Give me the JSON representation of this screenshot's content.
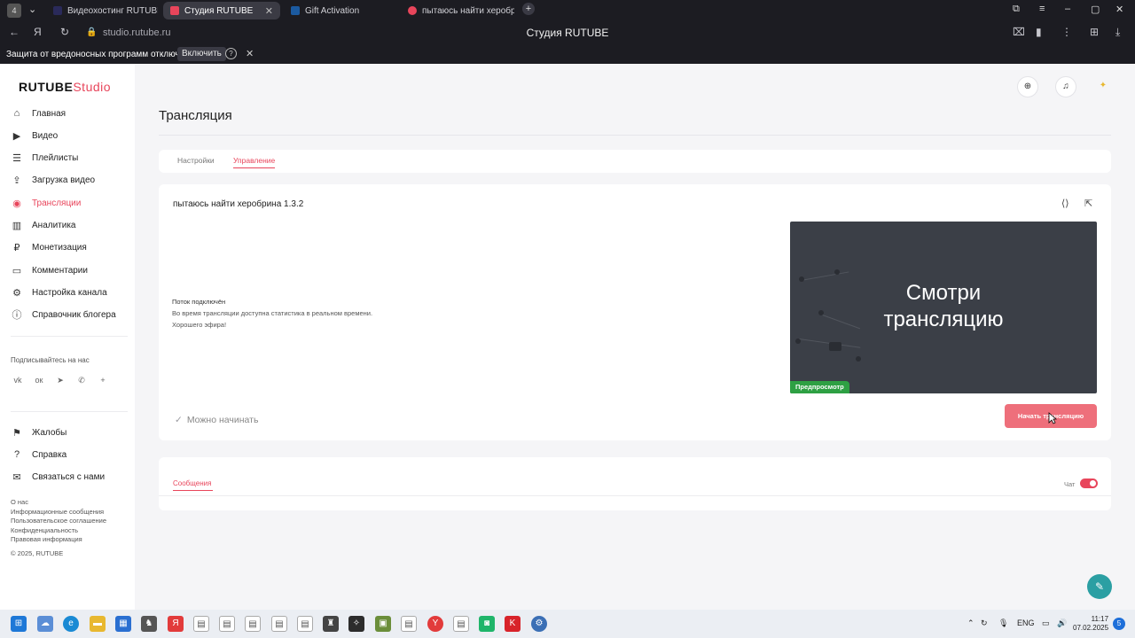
{
  "browser": {
    "tab_counter": "4",
    "tabs": [
      {
        "label": "Видеохостинг RUTUBE. С"
      },
      {
        "label": "Студия RUTUBE"
      },
      {
        "label": "Gift Activation"
      },
      {
        "label": "пытаюсь найти херобрина"
      }
    ],
    "url": "studio.rutube.ru",
    "page_title": "Студия RUTUBE",
    "warning_text": "Защита от вредоносных программ отключена",
    "warning_button": "Включить"
  },
  "logo": {
    "brand": "RUTUBE",
    "suffix": "Studio"
  },
  "sidebar": {
    "items": [
      {
        "label": "Главная",
        "icon": "home-icon"
      },
      {
        "label": "Видео",
        "icon": "video-icon"
      },
      {
        "label": "Плейлисты",
        "icon": "playlist-icon"
      },
      {
        "label": "Загрузка видео",
        "icon": "upload-icon"
      },
      {
        "label": "Трансляции",
        "icon": "broadcast-icon"
      },
      {
        "label": "Аналитика",
        "icon": "analytics-icon"
      },
      {
        "label": "Монетизация",
        "icon": "monetization-icon"
      },
      {
        "label": "Комментарии",
        "icon": "comments-icon"
      },
      {
        "label": "Настройка канала",
        "icon": "settings-icon"
      },
      {
        "label": "Справочник блогера",
        "icon": "info-icon"
      }
    ],
    "subscribe_label": "Подписывайтесь на нас",
    "bottom_items": [
      {
        "label": "Жалобы",
        "icon": "flag-icon"
      },
      {
        "label": "Справка",
        "icon": "help-icon"
      },
      {
        "label": "Связаться с нами",
        "icon": "mail-icon"
      }
    ],
    "footer_links": [
      "О нас",
      "Информационные сообщения",
      "Пользовательское соглашение",
      "Конфиденциальность",
      "Правовая информация"
    ],
    "copyright": "© 2025, RUTUBE"
  },
  "main": {
    "page_title": "Трансляция",
    "tabs": [
      {
        "label": "Настройки"
      },
      {
        "label": "Управление"
      }
    ],
    "stream_name": "пытаюсь найти херобрина 1.3.2",
    "status_title": "Поток подключён",
    "status_lines": [
      "Во время трансляции доступна статистика в реальном времени.",
      "Хорошего эфира!"
    ],
    "ready_label": "Можно начинать",
    "preview_line1": "Смотри",
    "preview_line2": "трансляцию",
    "preview_badge": "Предпросмотр",
    "start_button": "Начать трансляцию",
    "messages_tab": "Сообщения",
    "chat_label": "Чат"
  },
  "taskbar": {
    "lang": "ENG",
    "time": "11:17",
    "date": "07.02.2025",
    "notifications": "5"
  },
  "colors": {
    "accent": "#e8455b",
    "start_button": "#ee6f7b",
    "preview_bg": "#3b3f47",
    "preview_badge": "#2ea043",
    "support": "#2b9fa3"
  }
}
